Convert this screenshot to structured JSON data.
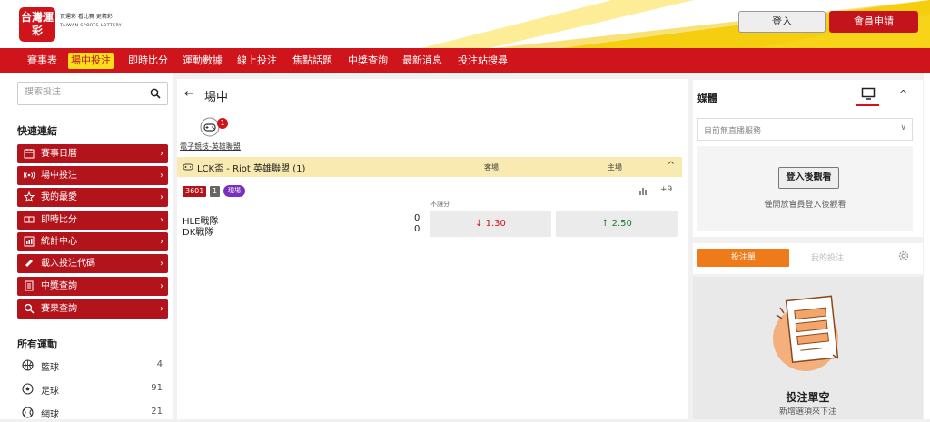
{
  "header": {
    "logo_text": "台灣運彩",
    "logo_sub_line1": "買運彩 看比賽 更精彩",
    "logo_sub_line2": "TAIWAN SPORTS LOTTERY",
    "login_label": "登入",
    "register_label": "會員申請"
  },
  "nav": {
    "items": [
      "賽事表",
      "場中投注",
      "即時比分",
      "運動數據",
      "線上投注",
      "焦點話題",
      "中獎查詢",
      "最新消息",
      "投注站搜尋"
    ],
    "active_index": 1
  },
  "sidebar": {
    "search_placeholder": "搜索投注",
    "quick_links_title": "快速連結",
    "quick_links": [
      {
        "label": "賽事日曆",
        "icon": "calendar-icon"
      },
      {
        "label": "場中投注",
        "icon": "live-signal-icon"
      },
      {
        "label": "我的最愛",
        "icon": "star-icon"
      },
      {
        "label": "即時比分",
        "icon": "scoreboard-icon"
      },
      {
        "label": "統計中心",
        "icon": "chart-icon"
      },
      {
        "label": "載入投注代碼",
        "icon": "ticket-icon"
      },
      {
        "label": "中獎查詢",
        "icon": "document-icon"
      },
      {
        "label": "賽果查詢",
        "icon": "search-icon"
      }
    ],
    "chevron": "›",
    "all_sports_title": "所有運動",
    "sports": [
      {
        "label": "籃球",
        "count": "4",
        "icon": "basketball-icon"
      },
      {
        "label": "足球",
        "count": "91",
        "icon": "soccer-icon"
      },
      {
        "label": "網球",
        "count": "21",
        "icon": "tennis-icon"
      }
    ]
  },
  "main": {
    "back_arrow": "←",
    "title": "場中",
    "category": {
      "label": "電子競技-英雄聯盟",
      "badge": "1"
    },
    "league": {
      "name": "LCK盃 - Riot 英雄聯盟 (1)",
      "away_label": "客場",
      "home_label": "主場",
      "caret": "^"
    },
    "match": {
      "id": "3601",
      "num": "1",
      "live": "現場",
      "more": "+9",
      "market": "不讓分",
      "team_away": "HLE戰隊",
      "team_home": "DK戰隊",
      "score_away": "0",
      "score_home": "0",
      "odd_away": "↓ 1.30",
      "odd_home": "↑ 2.50"
    }
  },
  "media": {
    "title": "媒體",
    "caret": "^",
    "live_status": "目前無直播服務",
    "watch_button": "登入後觀看",
    "watch_note": "僅開放會員登入後觀看"
  },
  "betslip": {
    "tab_slip": "投注單",
    "tab_my": "我的投注",
    "empty_title": "投注單空",
    "empty_sub": "新增選項來下注"
  },
  "colors": {
    "brand_red": "#d0141b",
    "brand_yellow": "#f7d418",
    "accent_orange": "#ef7a1a",
    "live_purple": "#7b2fbe"
  }
}
